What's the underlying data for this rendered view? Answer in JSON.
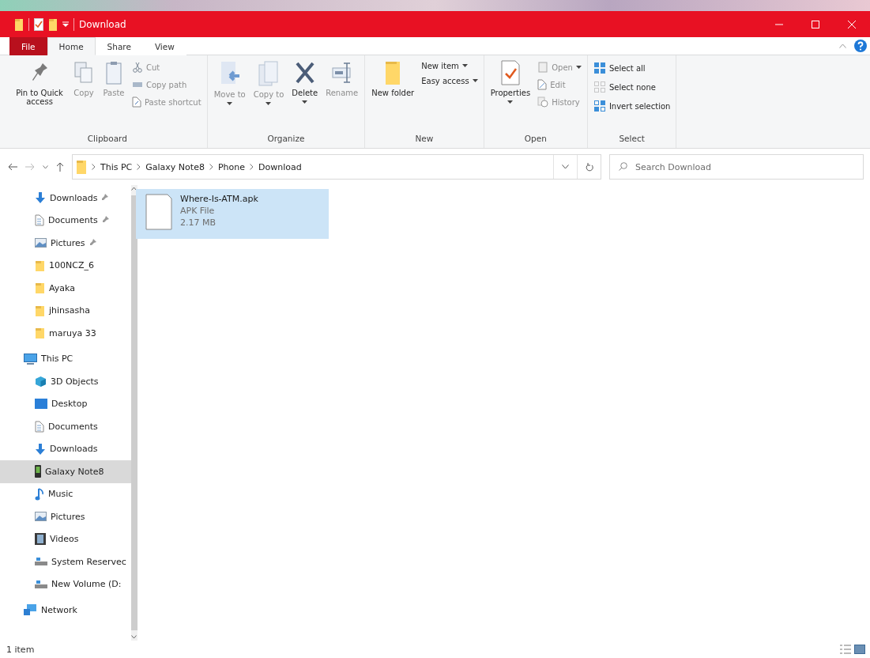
{
  "window": {
    "title": "Download"
  },
  "menu_tabs": [
    {
      "label": "File",
      "kind": "file",
      "selected": false
    },
    {
      "label": "Home",
      "kind": "tab",
      "selected": true
    },
    {
      "label": "Share",
      "kind": "tab",
      "selected": false
    },
    {
      "label": "View",
      "kind": "tab",
      "selected": false
    }
  ],
  "ribbon": {
    "groups": [
      {
        "label": "Clipboard",
        "items": [
          {
            "kind": "large",
            "label": "Pin to Quick access",
            "disabled": false,
            "dropdown": false
          },
          {
            "kind": "large",
            "label": "Copy",
            "disabled": true,
            "dropdown": false
          },
          {
            "kind": "large",
            "label": "Paste",
            "disabled": true,
            "dropdown": false
          },
          {
            "kind": "stack",
            "items": [
              {
                "label": "Cut",
                "disabled": true,
                "dropdown": false
              },
              {
                "label": "Copy path",
                "disabled": true,
                "dropdown": false
              },
              {
                "label": "Paste shortcut",
                "disabled": true,
                "dropdown": false
              }
            ]
          }
        ]
      },
      {
        "label": "Organize",
        "items": [
          {
            "kind": "large",
            "label": "Move to",
            "disabled": true,
            "dropdown": true
          },
          {
            "kind": "large",
            "label": "Copy to",
            "disabled": true,
            "dropdown": true
          },
          {
            "kind": "large",
            "label": "Delete",
            "disabled": false,
            "dropdown": true
          },
          {
            "kind": "large",
            "label": "Rename",
            "disabled": true,
            "dropdown": false
          }
        ]
      },
      {
        "label": "New",
        "items": [
          {
            "kind": "large",
            "label": "New folder",
            "disabled": false,
            "dropdown": false
          },
          {
            "kind": "stack",
            "items": [
              {
                "label": "New item",
                "disabled": false,
                "dropdown": true
              },
              {
                "label": "Easy access",
                "disabled": false,
                "dropdown": true
              }
            ]
          }
        ]
      },
      {
        "label": "Open",
        "items": [
          {
            "kind": "large",
            "label": "Properties",
            "disabled": false,
            "dropdown": true
          },
          {
            "kind": "stack",
            "items": [
              {
                "label": "Open",
                "disabled": true,
                "dropdown": true
              },
              {
                "label": "Edit",
                "disabled": true,
                "dropdown": false
              },
              {
                "label": "History",
                "disabled": true,
                "dropdown": false
              }
            ]
          }
        ]
      },
      {
        "label": "Select",
        "items": [
          {
            "kind": "stack",
            "items": [
              {
                "label": "Select all",
                "disabled": false,
                "dropdown": false
              },
              {
                "label": "Select none",
                "disabled": false,
                "dropdown": false
              },
              {
                "label": "Invert selection",
                "disabled": false,
                "dropdown": false
              }
            ]
          }
        ]
      }
    ]
  },
  "address": {
    "crumbs": [
      "This PC",
      "Galaxy Note8",
      "Phone",
      "Download"
    ]
  },
  "search": {
    "placeholder": "Search Download"
  },
  "sidebar": {
    "quick_access_children": [
      {
        "label": "Downloads",
        "kind": "downloads",
        "pinned": true,
        "selected": false
      },
      {
        "label": "Documents",
        "kind": "documents",
        "pinned": true,
        "selected": false
      },
      {
        "label": "Pictures",
        "kind": "pictures",
        "pinned": true,
        "selected": false
      },
      {
        "label": "100NCZ_6",
        "kind": "folder",
        "pinned": false,
        "selected": false
      },
      {
        "label": "Ayaka",
        "kind": "folder",
        "pinned": false,
        "selected": false
      },
      {
        "label": "jhinsasha",
        "kind": "folder",
        "pinned": false,
        "selected": false
      },
      {
        "label": "maruya 33",
        "kind": "folder",
        "pinned": false,
        "selected": false
      }
    ],
    "items": [
      {
        "label": "This PC",
        "kind": "pc",
        "selected": false,
        "children": [
          {
            "label": "3D Objects",
            "kind": "objects",
            "selected": false
          },
          {
            "label": "Desktop",
            "kind": "desktop",
            "selected": false
          },
          {
            "label": "Documents",
            "kind": "documents",
            "selected": false
          },
          {
            "label": "Downloads",
            "kind": "downloads",
            "selected": false
          },
          {
            "label": "Galaxy Note8",
            "kind": "phone",
            "selected": true
          },
          {
            "label": "Music",
            "kind": "music",
            "selected": false
          },
          {
            "label": "Pictures",
            "kind": "pictures",
            "selected": false
          },
          {
            "label": "Videos",
            "kind": "videos",
            "selected": false
          },
          {
            "label": "System Reservec",
            "kind": "drive",
            "selected": false
          },
          {
            "label": "New Volume (D:",
            "kind": "drive",
            "selected": false
          }
        ]
      },
      {
        "label": "Network",
        "kind": "network",
        "selected": false
      }
    ]
  },
  "files": [
    {
      "name": "Where-Is-ATM.apk",
      "type": "APK File",
      "size": "2.17 MB",
      "selected": true
    }
  ],
  "status_bar": {
    "count": "1 item"
  }
}
